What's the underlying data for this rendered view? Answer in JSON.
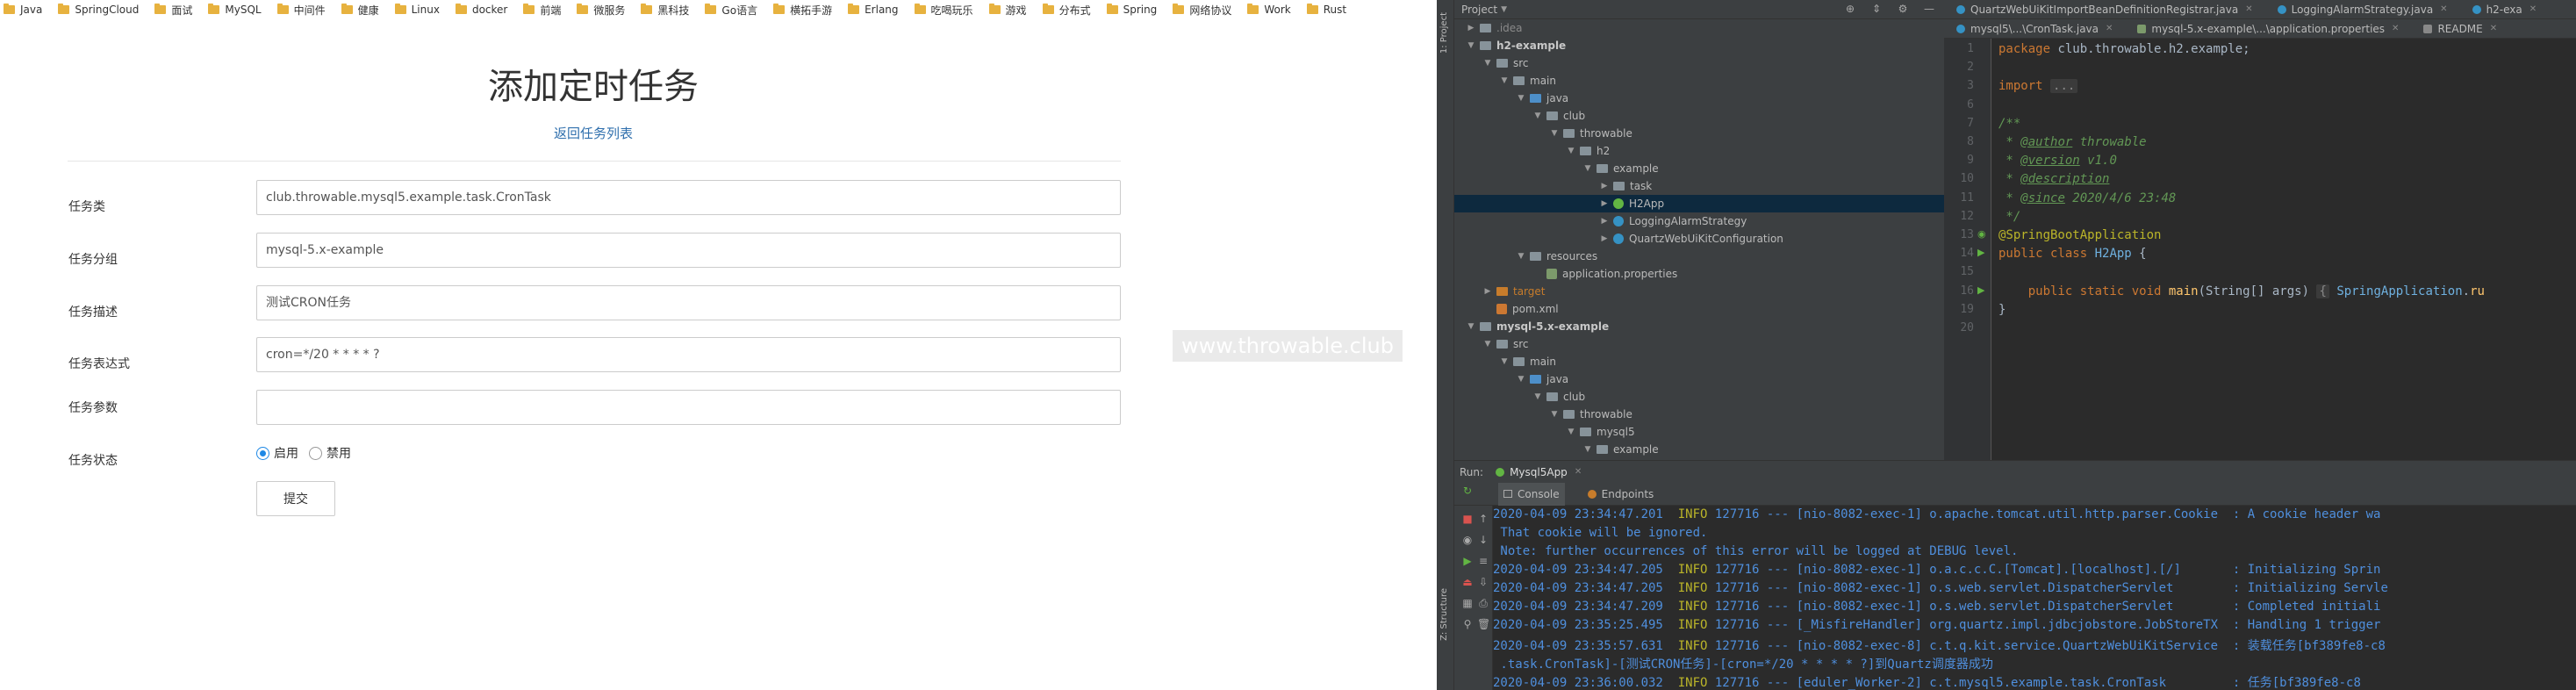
{
  "browser": {
    "bookmarks": [
      "Java",
      "SpringCloud",
      "面试",
      "MySQL",
      "中间件",
      "健康",
      "Linux",
      "docker",
      "前端",
      "微服务",
      "黑科技",
      "Go语言",
      "横拓手游",
      "Erlang",
      "吃喝玩乐",
      "游戏",
      "分布式",
      "Spring",
      "网络协议",
      "Work",
      "Rust"
    ],
    "page_title": "添加定时任务",
    "back_link": "返回任务列表",
    "fields": [
      {
        "label": "任务类",
        "value": "club.throwable.mysql5.example.task.CronTask"
      },
      {
        "label": "任务分组",
        "value": "mysql-5.x-example"
      },
      {
        "label": "任务描述",
        "value": "测试CRON任务"
      },
      {
        "label": "任务表达式",
        "value": "cron=*/20 * * * * ?"
      },
      {
        "label": "任务参数",
        "value": ""
      }
    ],
    "status_label": "任务状态",
    "status_options": [
      {
        "label": "启用",
        "checked": true
      },
      {
        "label": "禁用",
        "checked": false
      }
    ],
    "submit_label": "提交",
    "watermark": "www.throwable.club"
  },
  "ide": {
    "side_tabs": [
      "1: Project",
      "Z: Structure"
    ],
    "project_header": "Project",
    "tree": [
      {
        "label": ".idea",
        "indent": 1,
        "icon": "folder-gray",
        "toggle": "▶",
        "style": "dim"
      },
      {
        "label": "h2-example",
        "indent": 1,
        "icon": "folder-gray",
        "toggle": "▼",
        "style": "bold"
      },
      {
        "label": "src",
        "indent": 2,
        "icon": "folder-gray",
        "toggle": "▼",
        "style": ""
      },
      {
        "label": "main",
        "indent": 3,
        "icon": "folder-gray",
        "toggle": "▼",
        "style": ""
      },
      {
        "label": "java",
        "indent": 4,
        "icon": "folder-blue",
        "toggle": "▼",
        "style": ""
      },
      {
        "label": "club",
        "indent": 5,
        "icon": "folder-gray",
        "toggle": "▼",
        "style": ""
      },
      {
        "label": "throwable",
        "indent": 6,
        "icon": "folder-gray",
        "toggle": "▼",
        "style": ""
      },
      {
        "label": "h2",
        "indent": 7,
        "icon": "folder-gray",
        "toggle": "▼",
        "style": ""
      },
      {
        "label": "example",
        "indent": 8,
        "icon": "folder-gray",
        "toggle": "▼",
        "style": ""
      },
      {
        "label": "task",
        "indent": 9,
        "icon": "folder-gray",
        "toggle": "▶",
        "style": ""
      },
      {
        "label": "H2App",
        "indent": 9,
        "icon": "class-green",
        "toggle": "▶",
        "style": "selected"
      },
      {
        "label": "LoggingAlarmStrategy",
        "indent": 9,
        "icon": "class-blue",
        "toggle": "▶",
        "style": ""
      },
      {
        "label": "QuartzWebUiKitConfiguration",
        "indent": 9,
        "icon": "class-blue",
        "toggle": "▶",
        "style": ""
      },
      {
        "label": "resources",
        "indent": 4,
        "icon": "folder-gray",
        "toggle": "▼",
        "style": ""
      },
      {
        "label": "application.properties",
        "indent": 5,
        "icon": "prop",
        "toggle": "",
        "style": ""
      },
      {
        "label": "target",
        "indent": 2,
        "icon": "folder-orange",
        "toggle": "▶",
        "style": "target"
      },
      {
        "label": "pom.xml",
        "indent": 2,
        "icon": "xml",
        "toggle": "",
        "style": ""
      },
      {
        "label": "mysql-5.x-example",
        "indent": 1,
        "icon": "folder-gray",
        "toggle": "▼",
        "style": "bold"
      },
      {
        "label": "src",
        "indent": 2,
        "icon": "folder-gray",
        "toggle": "▼",
        "style": ""
      },
      {
        "label": "main",
        "indent": 3,
        "icon": "folder-gray",
        "toggle": "▼",
        "style": ""
      },
      {
        "label": "java",
        "indent": 4,
        "icon": "folder-blue",
        "toggle": "▼",
        "style": ""
      },
      {
        "label": "club",
        "indent": 5,
        "icon": "folder-gray",
        "toggle": "▼",
        "style": ""
      },
      {
        "label": "throwable",
        "indent": 6,
        "icon": "folder-gray",
        "toggle": "▼",
        "style": ""
      },
      {
        "label": "mysql5",
        "indent": 7,
        "icon": "folder-gray",
        "toggle": "▼",
        "style": ""
      },
      {
        "label": "example",
        "indent": 8,
        "icon": "folder-gray",
        "toggle": "▼",
        "style": ""
      }
    ],
    "tabs_row1": [
      {
        "label": "QuartzWebUiKitImportBeanDefinitionRegistrar.java",
        "icon": "class",
        "active": false
      },
      {
        "label": "LoggingAlarmStrategy.java",
        "icon": "class",
        "active": false
      },
      {
        "label": "h2-exa",
        "icon": "class",
        "active": false
      }
    ],
    "tabs_row2": [
      {
        "label": "mysql5\\...\\CronTask.java",
        "icon": "class",
        "active": false
      },
      {
        "label": "mysql-5.x-example\\...\\application.properties",
        "icon": "prop",
        "active": false
      },
      {
        "label": "README",
        "icon": "readme",
        "active": false
      }
    ],
    "code_lines": [
      {
        "n": "1",
        "html": "<span class=\"kw\">package</span> club.throwable.h2.example;"
      },
      {
        "n": "2",
        "html": ""
      },
      {
        "n": "3",
        "html": "<span class=\"kw\">import</span> <span class=\"fold\">...</span>"
      },
      {
        "n": "6",
        "html": ""
      },
      {
        "n": "7",
        "html": "<span class=\"cm\">/**</span>"
      },
      {
        "n": "8",
        "html": "<span class=\"cm\"> * </span><span class=\"tag\">@author</span><span class=\"cm\"> throwable</span>"
      },
      {
        "n": "9",
        "html": "<span class=\"cm\"> * </span><span class=\"tag\">@version</span><span class=\"cm\"> v1.0</span>"
      },
      {
        "n": "10",
        "html": "<span class=\"cm\"> * </span><span class=\"tag\">@description</span>"
      },
      {
        "n": "11",
        "html": "<span class=\"cm\"> * </span><span class=\"tag\">@since</span><span class=\"cm\"> 2020/4/6 23:48</span>"
      },
      {
        "n": "12",
        "html": "<span class=\"cm\"> */</span>"
      },
      {
        "n": "13",
        "html": "<span class=\"an\">@SpringBootApplication</span>"
      },
      {
        "n": "14",
        "html": "<span class=\"kw\">public class</span> <span class=\"cls\">H2App</span> {"
      },
      {
        "n": "15",
        "html": ""
      },
      {
        "n": "16",
        "html": "    <span class=\"kw\">public static void</span> <span class=\"fn\">main</span>(String[] args) <span class=\"fold\">{</span> <span class=\"cls\">SpringApplication</span>.<span class=\"fn\">ru</span>"
      },
      {
        "n": "19",
        "html": "}"
      },
      {
        "n": "20",
        "html": ""
      }
    ],
    "run_label": "Run:",
    "run_config": "Mysql5App",
    "console_tabs": [
      "Console",
      "Endpoints"
    ],
    "log_lines": [
      "2020-04-09 23:34:47.201  <span class=\"info\">INFO</span> 127716 --- [nio-8082-exec-1] o.apache.tomcat.util.http.parser.Cookie  : A cookie header wa",
      " That cookie will be ignored.",
      " Note: further occurrences of this error will be logged at DEBUG level.",
      "2020-04-09 23:34:47.205  <span class=\"info\">INFO</span> 127716 --- [nio-8082-exec-1] o.a.c.c.C.[Tomcat].[localhost].[/]       : Initializing Sprin",
      "2020-04-09 23:34:47.205  <span class=\"info\">INFO</span> 127716 --- [nio-8082-exec-1] o.s.web.servlet.DispatcherServlet        : Initializing Servle",
      "2020-04-09 23:34:47.209  <span class=\"info\">INFO</span> 127716 --- [nio-8082-exec-1] o.s.web.servlet.DispatcherServlet        : Completed initiali",
      "2020-04-09 23:35:25.495  <span class=\"info\">INFO</span> 127716 --- [_MisfireHandler] org.quartz.impl.jdbcjobstore.JobStoreTX  : Handling 1 trigger",
      "2020-04-09 23:35:57.631  <span class=\"info\">INFO</span> 127716 --- [nio-8082-exec-8] c.t.q.kit.service.QuartzWebUiKitService  : 装载任务[bf389fe8-c8",
      " .task.CronTask]-[测试CRON任务]-[cron=*/20 * * * * ?]到Quartz调度器成功",
      "2020-04-09 23:36:00.032  <span class=\"info\">INFO</span> 127716 --- [eduler_Worker-2] c.t.mysql5.example.task.CronTask         : 任务[bf389fe8-c8"
    ]
  }
}
